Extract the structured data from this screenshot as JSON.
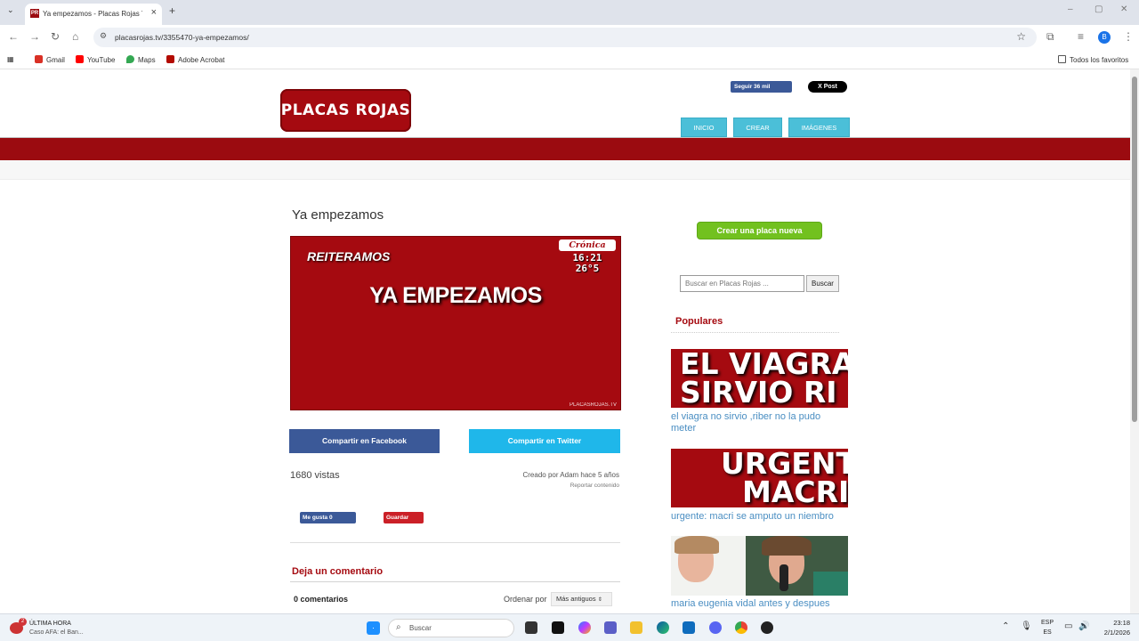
{
  "browser": {
    "tab_title": "Ya empezamos - Placas Rojas T",
    "tab_favicon": "PR",
    "new_tab": "+",
    "url": "placasrojas.tv/3355470-ya-empezamos/",
    "profile_initial": "B",
    "bookmarks": [
      {
        "label": "Gmail",
        "icon": "gmail-icon",
        "color": "#d93025"
      },
      {
        "label": "YouTube",
        "icon": "youtube-icon",
        "color": "#ff0000"
      },
      {
        "label": "Maps",
        "icon": "maps-icon",
        "color": "#34a853"
      },
      {
        "label": "Adobe Acrobat",
        "icon": "acrobat-icon",
        "color": "#b30b00"
      }
    ],
    "all_bookmarks": "Todos los favoritos"
  },
  "site": {
    "logo": "PLACAS ROJAS",
    "fb_follow": "Seguir 36 mil",
    "x_post": "X Post",
    "nav": [
      "INICIO",
      "CREAR",
      "IMÁGENES"
    ],
    "accent": "#9b0b10",
    "nav_color": "#4bbfd8"
  },
  "post": {
    "title": "Ya empezamos",
    "placa": {
      "subtitle": "REITERAMOS",
      "headline": "YA EMPEZAMOS",
      "channel": "Crónica",
      "time": "16:21",
      "temp": "26°5",
      "watermark": "PLACASROJAS.TV"
    },
    "share_facebook": "Compartir en Facebook",
    "share_twitter": "Compartir en Twitter",
    "views": "1680 vistas",
    "created_by": "Creado por Adam hace 5 años",
    "report": "Reportar contenido",
    "fb_like": "Me gusta 0",
    "pin_save": "Guardar"
  },
  "comments": {
    "heading": "Deja un comentario",
    "count": "0 comentarios",
    "sort_label": "Ordenar por",
    "sort_value": "Más antiguos"
  },
  "sidebar": {
    "create_button": "Crear una placa nueva",
    "search_placeholder": "Buscar en Placas Rojas ...",
    "search_button": "Buscar",
    "popular_heading": "Populares",
    "popular": [
      {
        "thumb_text": "EL VIAGRA",
        "thumb_text2": "SIRVIO RI",
        "caption": "el viagra no sirvio ,riber no la pudo meter"
      },
      {
        "thumb_text": "URGENTE",
        "thumb_text2": "MACRI",
        "caption": "urgente: macri se amputo un niembro"
      },
      {
        "caption": "maria eugenia vidal antes y despues"
      }
    ]
  },
  "taskbar": {
    "news_title": "ÚLTIMA HORA",
    "news_sub": "Caso AFA: el Ban...",
    "news_badge": "2",
    "search": "Buscar",
    "lang1": "ESP",
    "lang2": "ES",
    "time": "23:18",
    "date": "2/1/2026"
  }
}
